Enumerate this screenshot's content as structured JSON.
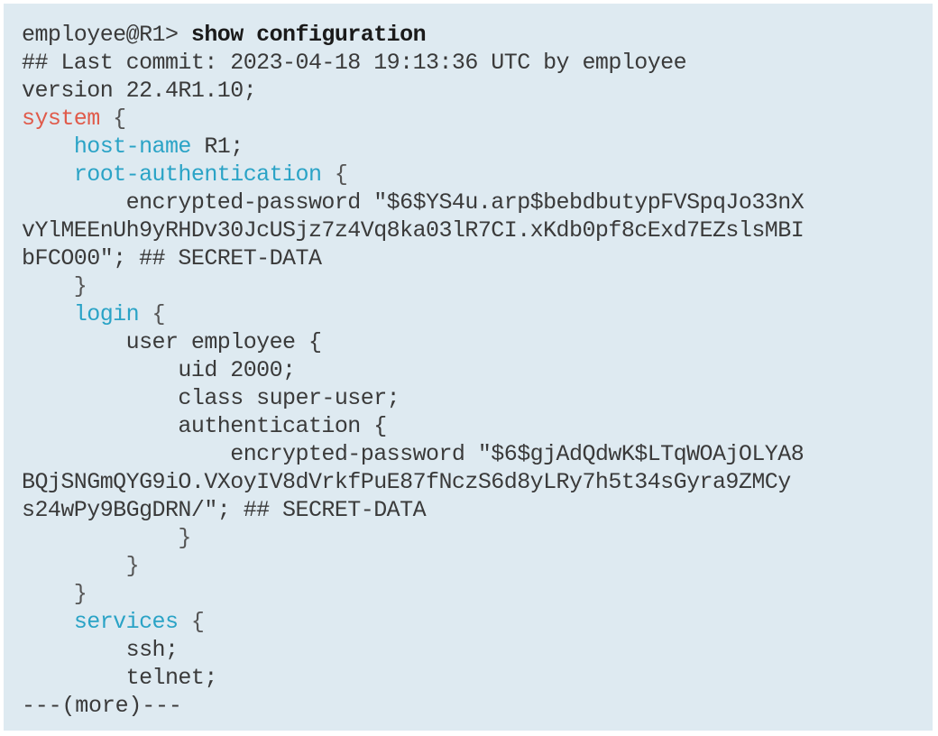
{
  "terminal": {
    "prompt": "employee@R1> ",
    "command": "show configuration",
    "lines": [
      "## Last commit: 2023-04-18 19:13:36 UTC by employee",
      "version 22.4R1.10;"
    ],
    "system": {
      "keyword": "system",
      "host_name_key": "host-name",
      "host_name_val": " R1;",
      "root_auth_key": "root-authentication",
      "root_password_prefix": "        encrypted-password \"$6$YS4u.arp$bebdbutypFVSpqJo33nX",
      "root_password_cont1": "vYlMEEnUh9yRHDv30JcUSjz7z4Vq8ka03lR7CI.xKdb0pf8cExd7EZslsMBI",
      "root_password_cont2": "bFCO00\"; ## SECRET-DATA",
      "login_key": "login",
      "user_line": "        user employee {",
      "uid_line": "            uid 2000;",
      "class_line": "            class super-user;",
      "auth_line": "            authentication {",
      "user_password_prefix": "                encrypted-password \"$6$gjAdQdwK$LTqWOAjOLYA8",
      "user_password_cont1": "BQjSNGmQYG9iO.VXoyIV8dVrkfPuE87fNczS6d8yLRy7h5t34sGyra9ZMCy",
      "user_password_cont2": "s24wPy9BGgDRN/\"; ## SECRET-DATA",
      "services_key": "services",
      "ssh_line": "        ssh;",
      "telnet_line": "        telnet;"
    },
    "more_prompt": "---(more)---"
  }
}
